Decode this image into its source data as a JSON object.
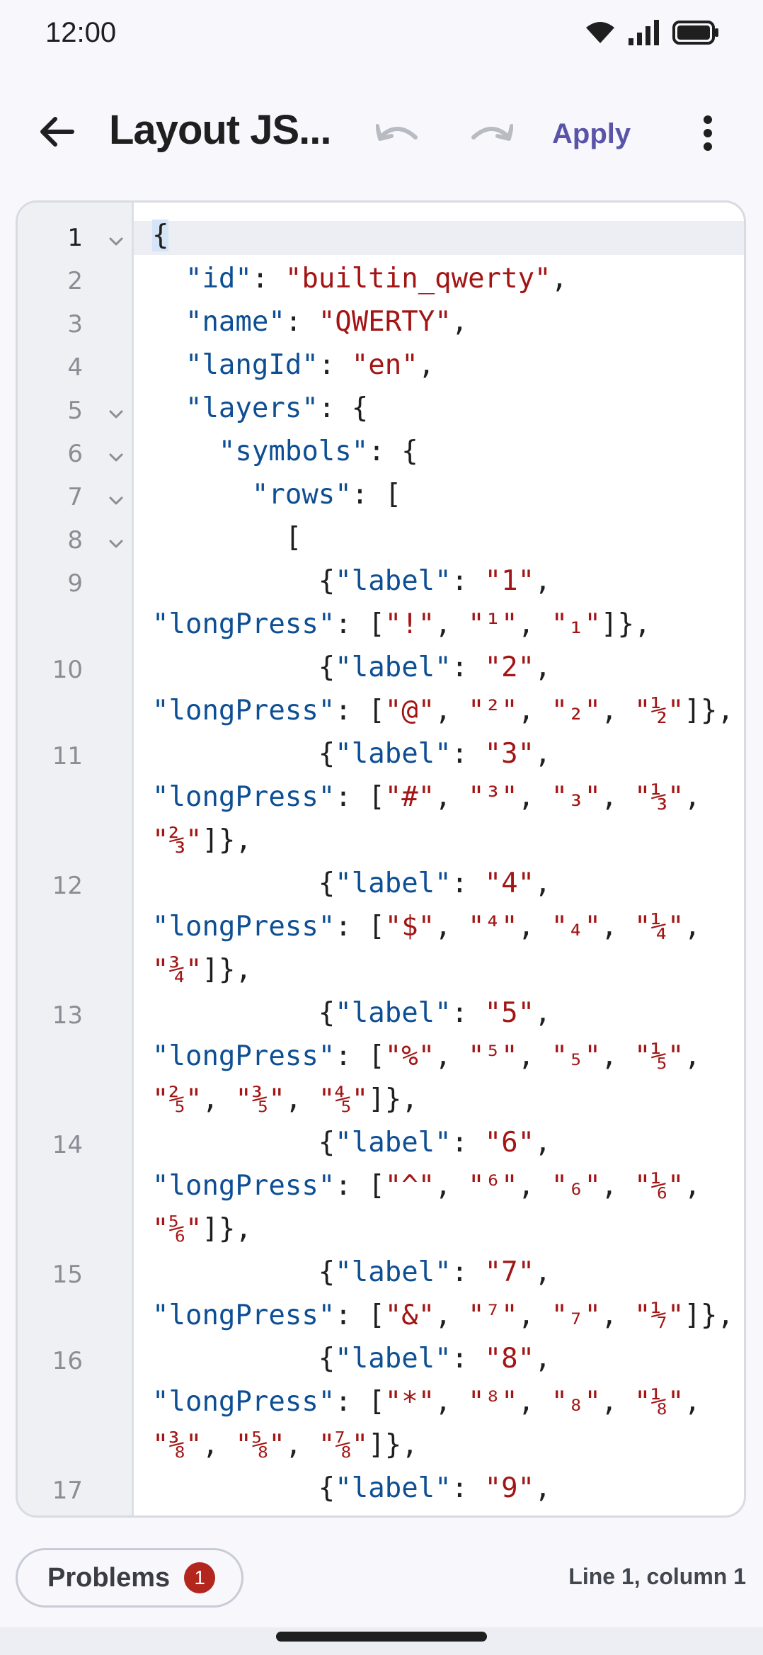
{
  "status_bar": {
    "time": "12:00",
    "icons": [
      "wifi-icon",
      "signal-icon",
      "battery-icon"
    ]
  },
  "toolbar": {
    "title": "Layout JS...",
    "back_icon": "arrow-left-icon",
    "undo_icon": "undo-icon",
    "redo_icon": "redo-icon",
    "apply_label": "Apply",
    "more_icon": "more-vert-icon"
  },
  "editor": {
    "active_line": 1,
    "gutter": [
      {
        "num": "1",
        "fold": true
      },
      {
        "num": "2",
        "fold": false
      },
      {
        "num": "3",
        "fold": false
      },
      {
        "num": "4",
        "fold": false
      },
      {
        "num": "5",
        "fold": true
      },
      {
        "num": "6",
        "fold": true
      },
      {
        "num": "7",
        "fold": true
      },
      {
        "num": "8",
        "fold": true
      },
      {
        "num": "9",
        "fold": false
      },
      {
        "num": "10",
        "fold": false
      },
      {
        "num": "11",
        "fold": false
      },
      {
        "num": "12",
        "fold": false
      },
      {
        "num": "13",
        "fold": false
      },
      {
        "num": "14",
        "fold": false
      },
      {
        "num": "15",
        "fold": false
      },
      {
        "num": "16",
        "fold": false
      },
      {
        "num": "17",
        "fold": false
      }
    ],
    "code_rows": [
      [
        [
          "p",
          "{"
        ]
      ],
      [
        [
          "p",
          "  "
        ],
        [
          "k",
          "\"id\""
        ],
        [
          "p",
          ": "
        ],
        [
          "s",
          "\"builtin_qwerty\""
        ],
        [
          "p",
          ","
        ]
      ],
      [
        [
          "p",
          "  "
        ],
        [
          "k",
          "\"name\""
        ],
        [
          "p",
          ": "
        ],
        [
          "s",
          "\"QWERTY\""
        ],
        [
          "p",
          ","
        ]
      ],
      [
        [
          "p",
          "  "
        ],
        [
          "k",
          "\"langId\""
        ],
        [
          "p",
          ": "
        ],
        [
          "s",
          "\"en\""
        ],
        [
          "p",
          ","
        ]
      ],
      [
        [
          "p",
          "  "
        ],
        [
          "k",
          "\"layers\""
        ],
        [
          "p",
          ": {"
        ]
      ],
      [
        [
          "p",
          "    "
        ],
        [
          "k",
          "\"symbols\""
        ],
        [
          "p",
          ": {"
        ]
      ],
      [
        [
          "p",
          "      "
        ],
        [
          "k",
          "\"rows\""
        ],
        [
          "p",
          ": ["
        ]
      ],
      [
        [
          "p",
          "        ["
        ]
      ],
      [
        [
          "p",
          "          {"
        ],
        [
          "k",
          "\"label\""
        ],
        [
          "p",
          ": "
        ],
        [
          "s",
          "\"1\""
        ],
        [
          "p",
          ","
        ]
      ],
      [
        [
          "k",
          "\"longPress\""
        ],
        [
          "p",
          ": ["
        ],
        [
          "s",
          "\"!\""
        ],
        [
          "p",
          ", "
        ],
        [
          "s",
          "\"¹\""
        ],
        [
          "p",
          ", "
        ],
        [
          "s",
          "\"₁\""
        ],
        [
          "p",
          "]},"
        ]
      ],
      [
        [
          "p",
          "          {"
        ],
        [
          "k",
          "\"label\""
        ],
        [
          "p",
          ": "
        ],
        [
          "s",
          "\"2\""
        ],
        [
          "p",
          ","
        ]
      ],
      [
        [
          "k",
          "\"longPress\""
        ],
        [
          "p",
          ": ["
        ],
        [
          "s",
          "\"@\""
        ],
        [
          "p",
          ", "
        ],
        [
          "s",
          "\"²\""
        ],
        [
          "p",
          ", "
        ],
        [
          "s",
          "\"₂\""
        ],
        [
          "p",
          ", "
        ],
        [
          "s",
          "\"½\""
        ],
        [
          "p",
          "]},"
        ]
      ],
      [
        [
          "p",
          "          {"
        ],
        [
          "k",
          "\"label\""
        ],
        [
          "p",
          ": "
        ],
        [
          "s",
          "\"3\""
        ],
        [
          "p",
          ","
        ]
      ],
      [
        [
          "k",
          "\"longPress\""
        ],
        [
          "p",
          ": ["
        ],
        [
          "s",
          "\"#\""
        ],
        [
          "p",
          ", "
        ],
        [
          "s",
          "\"³\""
        ],
        [
          "p",
          ", "
        ],
        [
          "s",
          "\"₃\""
        ],
        [
          "p",
          ", "
        ],
        [
          "s",
          "\"⅓\""
        ],
        [
          "p",
          ","
        ]
      ],
      [
        [
          "s",
          "\"⅔\""
        ],
        [
          "p",
          "]},"
        ]
      ],
      [
        [
          "p",
          "          {"
        ],
        [
          "k",
          "\"label\""
        ],
        [
          "p",
          ": "
        ],
        [
          "s",
          "\"4\""
        ],
        [
          "p",
          ","
        ]
      ],
      [
        [
          "k",
          "\"longPress\""
        ],
        [
          "p",
          ": ["
        ],
        [
          "s",
          "\"$\""
        ],
        [
          "p",
          ", "
        ],
        [
          "s",
          "\"⁴\""
        ],
        [
          "p",
          ", "
        ],
        [
          "s",
          "\"₄\""
        ],
        [
          "p",
          ", "
        ],
        [
          "s",
          "\"¼\""
        ],
        [
          "p",
          ","
        ]
      ],
      [
        [
          "s",
          "\"¾\""
        ],
        [
          "p",
          "]},"
        ]
      ],
      [
        [
          "p",
          "          {"
        ],
        [
          "k",
          "\"label\""
        ],
        [
          "p",
          ": "
        ],
        [
          "s",
          "\"5\""
        ],
        [
          "p",
          ","
        ]
      ],
      [
        [
          "k",
          "\"longPress\""
        ],
        [
          "p",
          ": ["
        ],
        [
          "s",
          "\"%\""
        ],
        [
          "p",
          ", "
        ],
        [
          "s",
          "\"⁵\""
        ],
        [
          "p",
          ", "
        ],
        [
          "s",
          "\"₅\""
        ],
        [
          "p",
          ", "
        ],
        [
          "s",
          "\"⅕\""
        ],
        [
          "p",
          ","
        ]
      ],
      [
        [
          "s",
          "\"⅖\""
        ],
        [
          "p",
          ", "
        ],
        [
          "s",
          "\"⅗\""
        ],
        [
          "p",
          ", "
        ],
        [
          "s",
          "\"⅘\""
        ],
        [
          "p",
          "]},"
        ]
      ],
      [
        [
          "p",
          "          {"
        ],
        [
          "k",
          "\"label\""
        ],
        [
          "p",
          ": "
        ],
        [
          "s",
          "\"6\""
        ],
        [
          "p",
          ","
        ]
      ],
      [
        [
          "k",
          "\"longPress\""
        ],
        [
          "p",
          ": ["
        ],
        [
          "s",
          "\"^\""
        ],
        [
          "p",
          ", "
        ],
        [
          "s",
          "\"⁶\""
        ],
        [
          "p",
          ", "
        ],
        [
          "s",
          "\"₆\""
        ],
        [
          "p",
          ", "
        ],
        [
          "s",
          "\"⅙\""
        ],
        [
          "p",
          ","
        ]
      ],
      [
        [
          "s",
          "\"⅚\""
        ],
        [
          "p",
          "]},"
        ]
      ],
      [
        [
          "p",
          "          {"
        ],
        [
          "k",
          "\"label\""
        ],
        [
          "p",
          ": "
        ],
        [
          "s",
          "\"7\""
        ],
        [
          "p",
          ","
        ]
      ],
      [
        [
          "k",
          "\"longPress\""
        ],
        [
          "p",
          ": ["
        ],
        [
          "s",
          "\"&\""
        ],
        [
          "p",
          ", "
        ],
        [
          "s",
          "\"⁷\""
        ],
        [
          "p",
          ", "
        ],
        [
          "s",
          "\"₇\""
        ],
        [
          "p",
          ", "
        ],
        [
          "s",
          "\"⅐\""
        ],
        [
          "p",
          "]},"
        ]
      ],
      [
        [
          "p",
          "          {"
        ],
        [
          "k",
          "\"label\""
        ],
        [
          "p",
          ": "
        ],
        [
          "s",
          "\"8\""
        ],
        [
          "p",
          ","
        ]
      ],
      [
        [
          "k",
          "\"longPress\""
        ],
        [
          "p",
          ": ["
        ],
        [
          "s",
          "\"*\""
        ],
        [
          "p",
          ", "
        ],
        [
          "s",
          "\"⁸\""
        ],
        [
          "p",
          ", "
        ],
        [
          "s",
          "\"₈\""
        ],
        [
          "p",
          ", "
        ],
        [
          "s",
          "\"⅛\""
        ],
        [
          "p",
          ","
        ]
      ],
      [
        [
          "s",
          "\"⅜\""
        ],
        [
          "p",
          ", "
        ],
        [
          "s",
          "\"⅝\""
        ],
        [
          "p",
          ", "
        ],
        [
          "s",
          "\"⅞\""
        ],
        [
          "p",
          "]},"
        ]
      ],
      [
        [
          "p",
          "          {"
        ],
        [
          "k",
          "\"label\""
        ],
        [
          "p",
          ": "
        ],
        [
          "s",
          "\"9\""
        ],
        [
          "p",
          ","
        ]
      ]
    ]
  },
  "bottom_bar": {
    "problems_label": "Problems",
    "problems_count": "1",
    "cursor_position": "Line 1, column 1"
  },
  "colors": {
    "accent": "#5a54a8",
    "key": "#0e4f94",
    "string": "#a31515",
    "error": "#b3261e"
  }
}
